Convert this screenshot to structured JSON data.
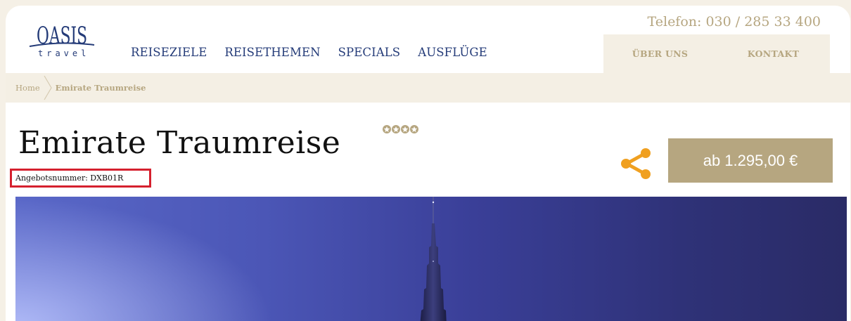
{
  "header": {
    "logo": {
      "name": "OASIS",
      "tagline": "travel"
    },
    "phone": "Telefon: 030 / 285 33 400",
    "nav": [
      "REISEZIELE",
      "REISETHEMEN",
      "SPECIALS",
      "AUSFLÜGE"
    ],
    "subnav": [
      "ÜBER UNS",
      "KONTAKT"
    ]
  },
  "breadcrumb": {
    "home": "Home",
    "current": "Emirate Traumreise"
  },
  "offer": {
    "title": "Emirate Traumreise",
    "stars": 4,
    "offer_number": "Angebotsnummer: DXB01R",
    "price": "ab 1.295,00 €"
  },
  "colors": {
    "accent": "#b6a680",
    "nav": "#243b78",
    "highlight_border": "#d5202e",
    "share": "#f0a020"
  },
  "icons": {
    "share": "share-icon",
    "star": "star-icon"
  }
}
